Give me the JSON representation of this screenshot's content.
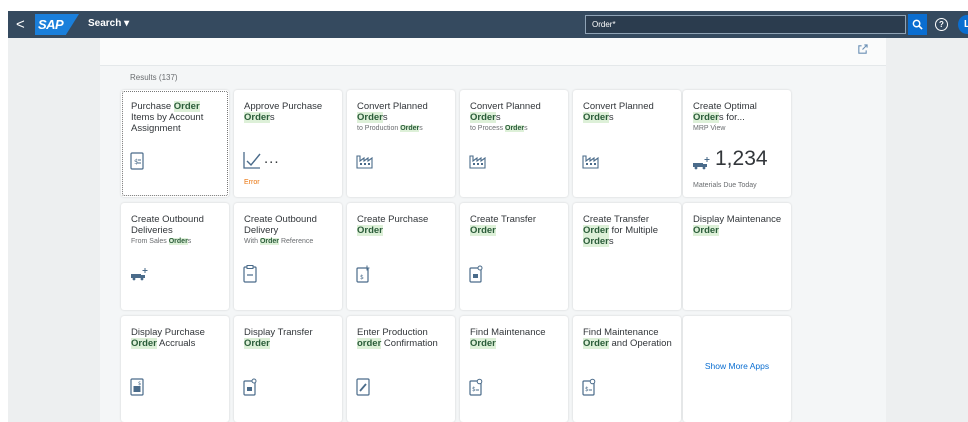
{
  "shell": {
    "back_glyph": "<",
    "logo": "SAP",
    "menu_label": "Search ▾",
    "search_value": "Order*",
    "help_glyph": "?",
    "avatar_initial": "L"
  },
  "results_label": "Results (137)",
  "tiles": [
    {
      "t1": "Purchase ",
      "h1": "Order",
      "t2": " Items by Account Assignment",
      "sub_pre": "",
      "sub_hl": "",
      "sub_post": "",
      "icon": "list-document-icon"
    },
    {
      "t1": "Approve Purchase ",
      "h1": "Order",
      "t2": "s",
      "status": "Error",
      "dots": "...",
      "icon": "approve-checkmark-icon"
    },
    {
      "t1": "Convert Planned ",
      "h1": "Order",
      "t2": "s",
      "sub_pre": "to Production ",
      "sub_hl": "Order",
      "sub_post": "s",
      "icon": "factory-icon"
    },
    {
      "t1": "Convert Planned ",
      "h1": "Order",
      "t2": "s",
      "sub_pre": "to Process ",
      "sub_hl": "Order",
      "sub_post": "s",
      "icon": "factory-icon"
    },
    {
      "t1": "Convert Planned ",
      "h1": "Order",
      "t2": "s",
      "icon": "factory-icon"
    },
    {
      "t1": "Create Optimal ",
      "h1": "Order",
      "t2": "s for...",
      "sub_pre": "MRP View",
      "kpi": "1,234",
      "footer": "Materials Due Today",
      "icon": "create-truck-icon"
    },
    {
      "t1": "Create Outbound Deliveries",
      "h1": "",
      "t2": "",
      "sub_pre": "From Sales ",
      "sub_hl": "Order",
      "sub_post": "s",
      "icon": "create-truck-icon"
    },
    {
      "t1": "Create Outbound Delivery",
      "h1": "",
      "t2": "",
      "sub_pre": "With ",
      "sub_hl": "Order",
      "sub_post": " Reference",
      "icon": "clipboard-icon"
    },
    {
      "t1": "Create Purchase ",
      "h1": "Order",
      "t2": "",
      "icon": "create-document-icon"
    },
    {
      "t1": "Create Transfer ",
      "h1": "Order",
      "t2": "",
      "icon": "transfer-document-icon"
    },
    {
      "t1": "Create Transfer ",
      "h1": "Order",
      "t2": " for Multiple ",
      "h2": "Order",
      "t3": "s",
      "icon": ""
    },
    {
      "t1": "Display Maintenance ",
      "h1": "Order",
      "t2": "",
      "icon": ""
    },
    {
      "t1": "Display Purchase ",
      "h1": "Order",
      "t2": " Accruals",
      "icon": "accruals-document-icon"
    },
    {
      "t1": "Display Transfer ",
      "h1": "Order",
      "t2": "",
      "icon": "transfer-document-icon"
    },
    {
      "t1": "Enter Production ",
      "h1": "order",
      "t2": " Confirmation",
      "icon": "edit-document-icon"
    },
    {
      "t1": "Find Maintenance ",
      "h1": "Order",
      "t2": "",
      "icon": "search-document-icon"
    },
    {
      "t1": "Find Maintenance ",
      "h1": "Order",
      "t2": " and Operation",
      "icon": "search-document-icon"
    }
  ],
  "show_more_label": "Show More Apps",
  "colors": {
    "shell": "#354a5f",
    "accent": "#0a6ed1",
    "highlight_bg": "#ddf0d8",
    "highlight_text": "#2b5d3a",
    "error": "#e9730c"
  }
}
